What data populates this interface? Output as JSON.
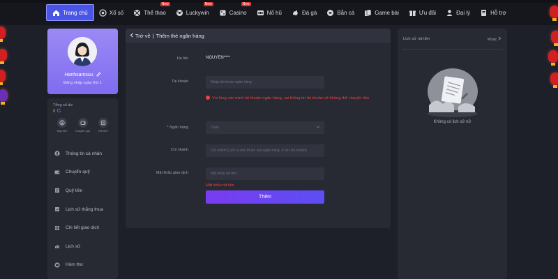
{
  "nav": {
    "items": [
      {
        "label": "Trang chủ",
        "icon": "home-icon",
        "active": true
      },
      {
        "label": "Xổ số",
        "icon": "lottery-icon"
      },
      {
        "label": "Thể thao",
        "icon": "sports-icon",
        "badge": "New"
      },
      {
        "label": "Luckywin",
        "icon": "luckywin-icon",
        "badge": "New"
      },
      {
        "label": "Casino",
        "icon": "casino-icon",
        "badge": "New"
      },
      {
        "label": "Nổ hũ",
        "icon": "jackpot-icon"
      },
      {
        "label": "Đá gà",
        "icon": "cockfight-icon"
      },
      {
        "label": "Bắn cá",
        "icon": "fishing-icon"
      },
      {
        "label": "Game bài",
        "icon": "cards-icon"
      },
      {
        "label": "Ưu đãi",
        "icon": "promo-icon"
      },
      {
        "label": "Đại lý",
        "icon": "agent-icon"
      },
      {
        "label": "Hỗ trợ",
        "icon": "support-icon"
      }
    ]
  },
  "profile": {
    "username": "Hanhsamsuu",
    "login_text": "Đăng nhập ngày thứ 1"
  },
  "wallet": {
    "balance_label": "Tổng số dư",
    "balance": "0",
    "actions": [
      {
        "label": "Nạp tiền",
        "icon": "deposit-icon"
      },
      {
        "label": "Chuyển quỹ",
        "icon": "transfer-icon"
      },
      {
        "label": "Rút tiền",
        "icon": "withdraw-icon"
      }
    ]
  },
  "menu": {
    "items": [
      {
        "label": "Thông tin cá nhân",
        "icon": "user-icon"
      },
      {
        "label": "Chuyển quỹ",
        "icon": "transfer-icon"
      },
      {
        "label": "Quỹ tiền",
        "icon": "fund-icon"
      },
      {
        "label": "Lịch sử thắng thua",
        "icon": "history-icon"
      },
      {
        "label": "Chi tiết giao dịch",
        "icon": "transaction-icon"
      },
      {
        "label": "Lịch sử",
        "icon": "chart-icon"
      },
      {
        "label": "Hòm thư",
        "icon": "mailbox-icon"
      }
    ]
  },
  "form": {
    "back_label": "Trở về",
    "title": "Thêm thẻ ngân hàng",
    "holder_label": "Họ tên",
    "holder_value": "NGUYEN****",
    "account_label": "Tài khoản",
    "account_placeholder": "Nhập tài khoản ngân hàng",
    "warning": "Vui lòng xác minh tài khoản ngân hàng, sai thông tin tài khoản sẽ không thể chuyển tiền",
    "bank_label": "* Ngân hàng",
    "bank_placeholder": "Chọn",
    "branch_label": "Chi nhánh",
    "branch_placeholder": "Chi nhánh (Lịch ra nếu thuộc của ngân hàng, ở tên chi nhánh)",
    "pin_label": "Mật khẩu giao dịch",
    "pin_placeholder": "Mật khẩu rút tiền",
    "pin_error": "Mật khẩu rút tiền",
    "submit_label": "Thêm"
  },
  "withdraw_history": {
    "title": "Lịch sử rút tiền",
    "other_label": "Khác",
    "empty_text": "Không có lịch sử nữ"
  },
  "colors": {
    "accent": "#4a55e6",
    "profile_bg": "#8c7bf2",
    "error": "#e84545",
    "button": "#6a45f1"
  }
}
